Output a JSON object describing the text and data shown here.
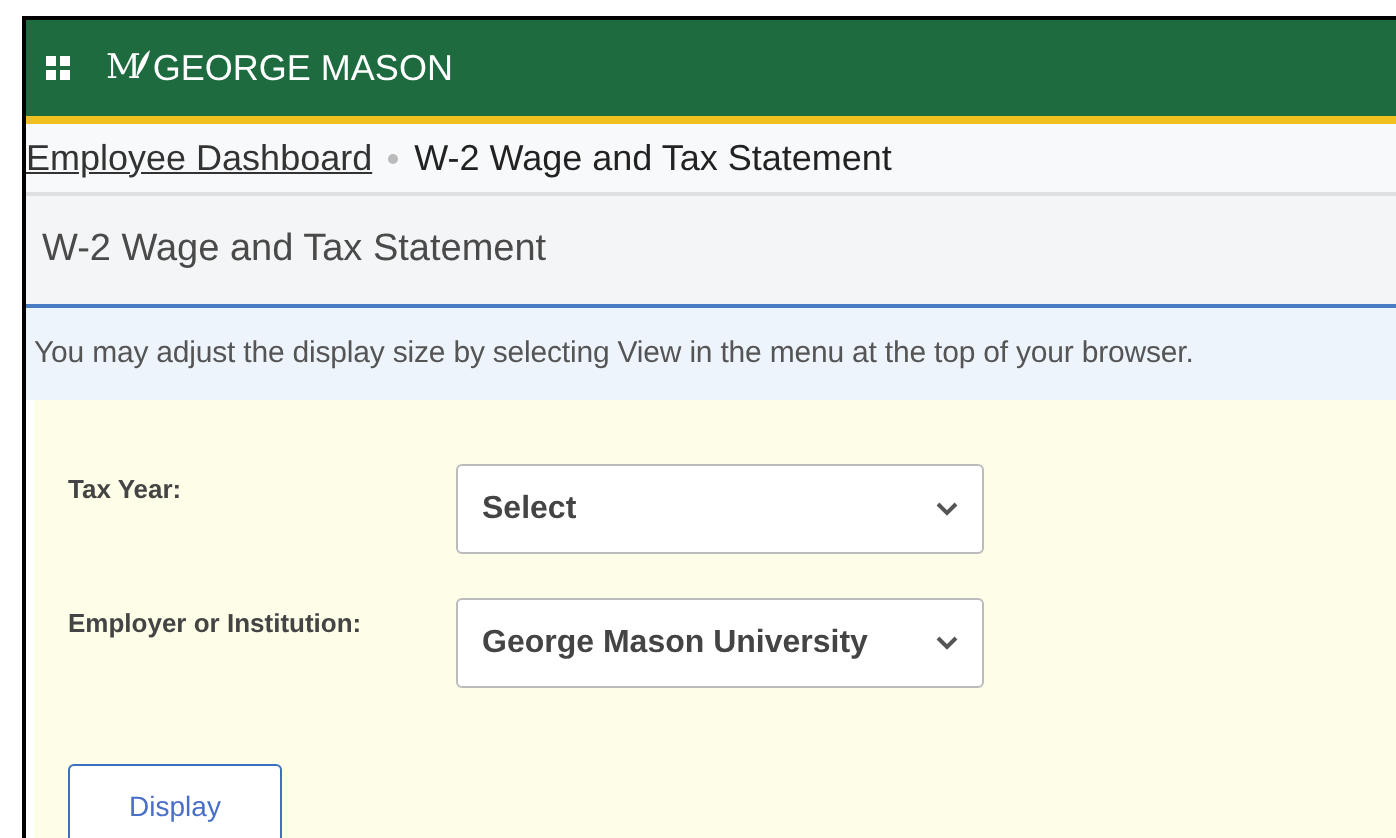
{
  "header": {
    "logo_mark": "M",
    "logo_text": "GEORGE MASON"
  },
  "breadcrumb": [
    {
      "label": "Employee Dashboard",
      "kind": "link"
    },
    {
      "label": "W-2 Wage and Tax Statement",
      "kind": "current"
    }
  ],
  "page_title": "W-2 Wage and Tax Statement",
  "notice": "You may adjust the display size by selecting View in the menu at the top of your browser.",
  "form": {
    "fields": [
      {
        "label": "Tax Year:",
        "value": "Select"
      },
      {
        "label": "Employer or Institution:",
        "value": "George Mason University"
      }
    ],
    "button": "Display"
  }
}
